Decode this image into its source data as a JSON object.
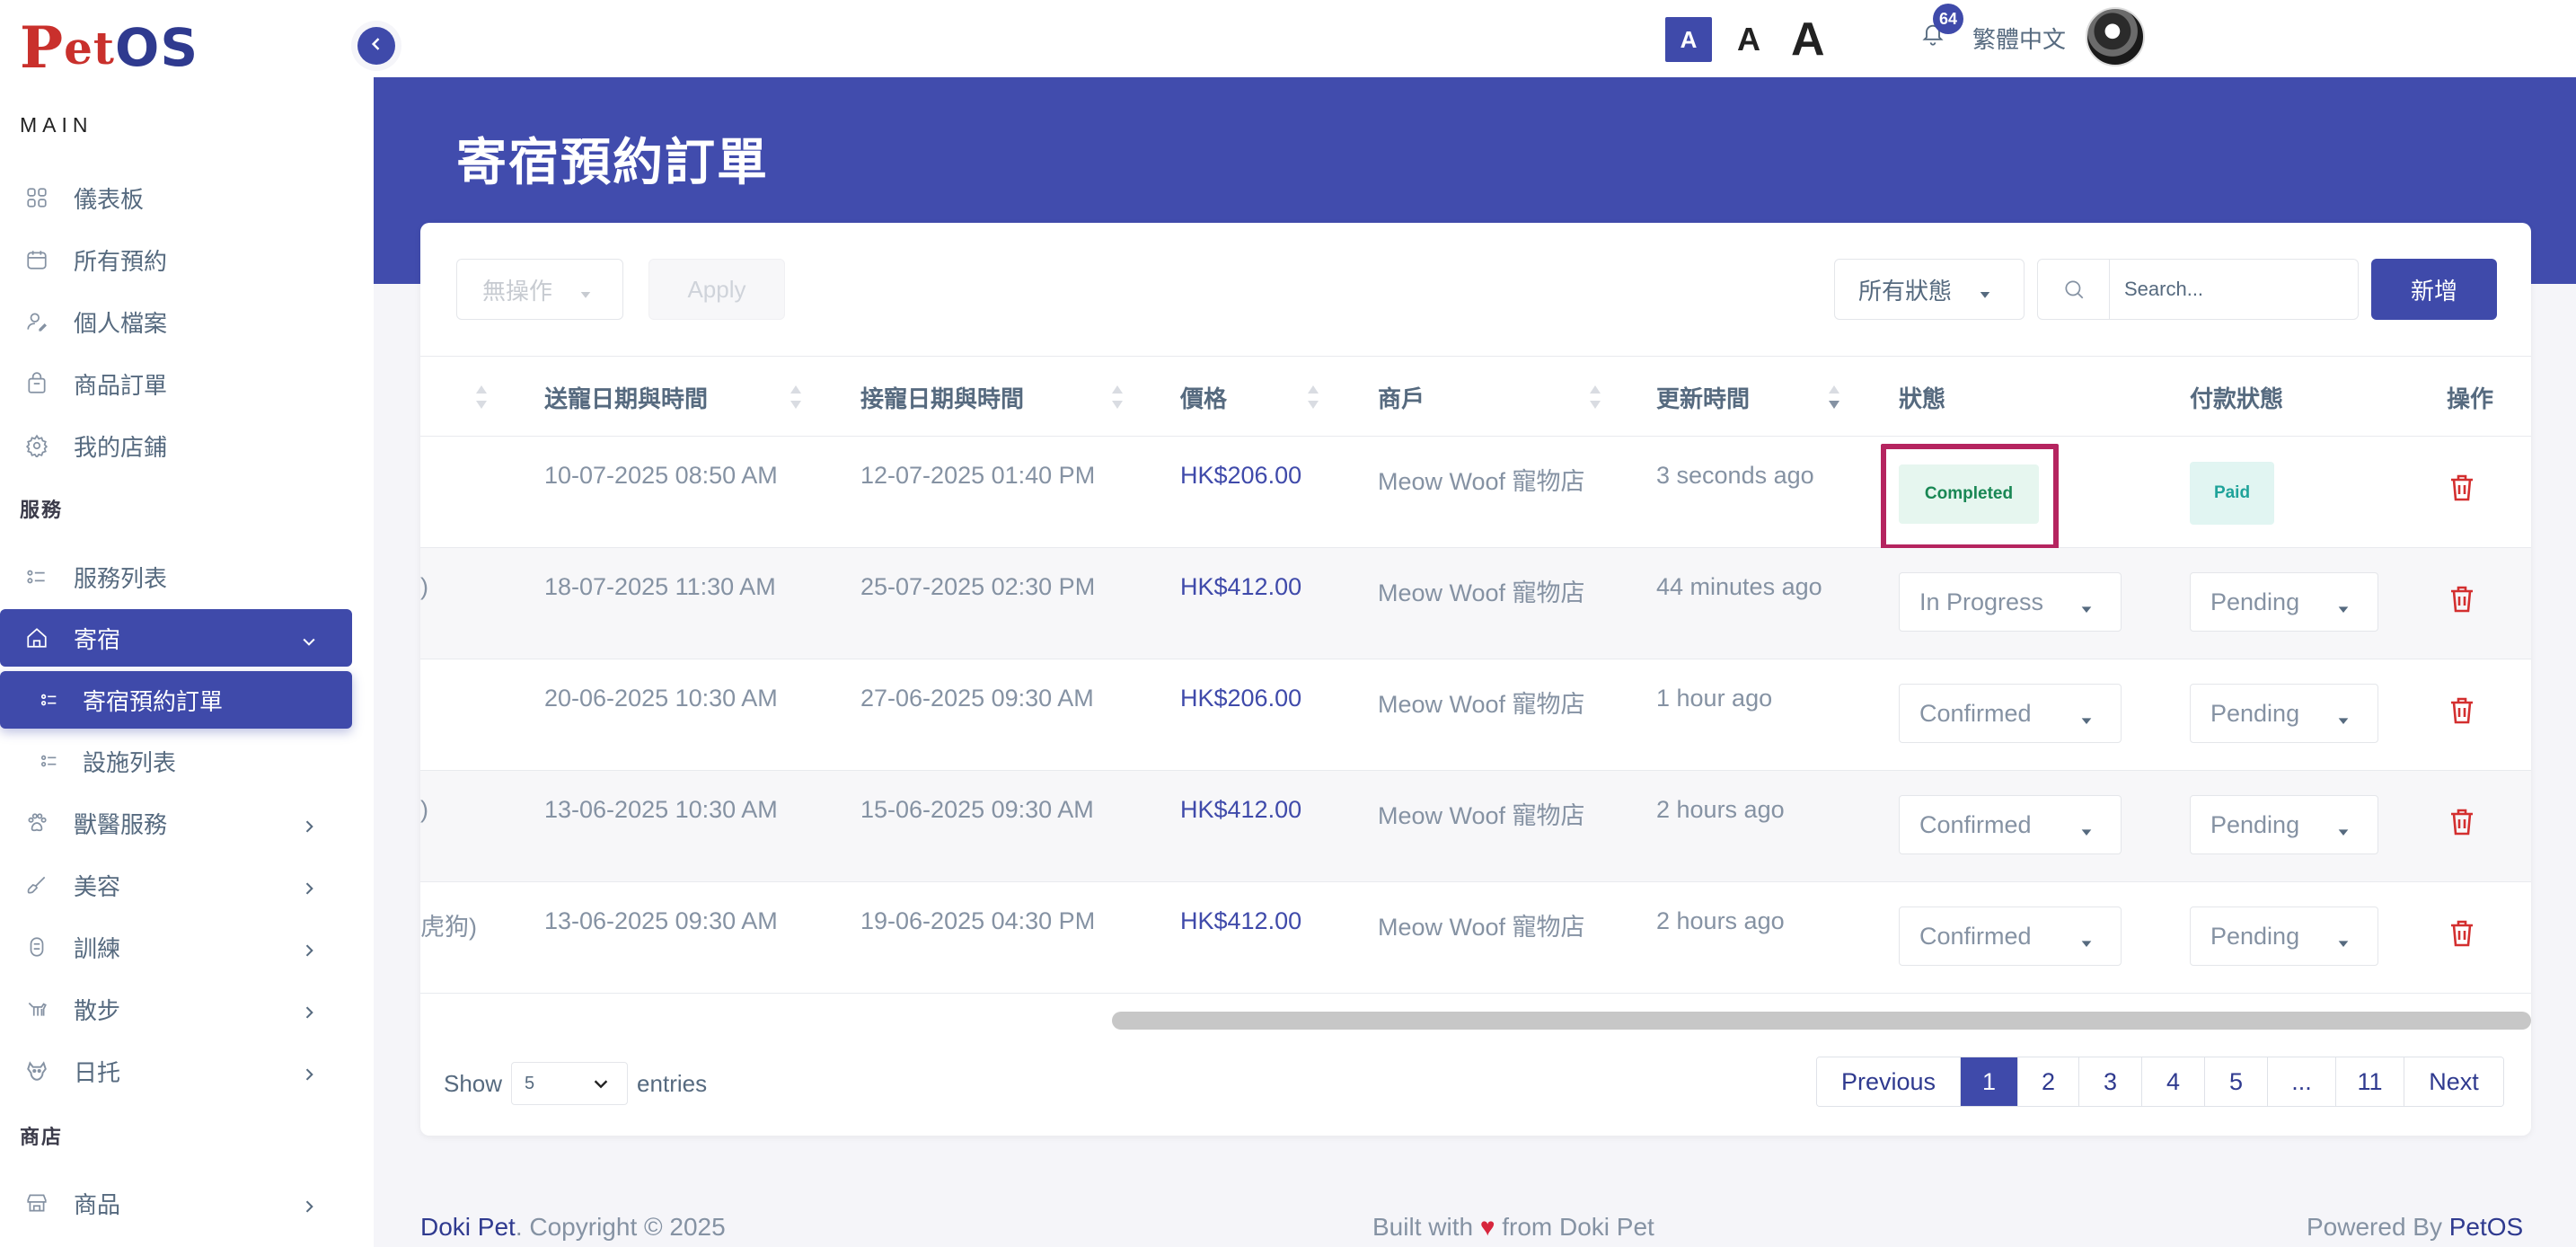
{
  "app": {
    "logo_p": "P",
    "logo_et": "et",
    "logo_os": "OS"
  },
  "sidebar": {
    "section_main": "MAIN",
    "section_services": "服務",
    "section_shop": "商店",
    "items": [
      {
        "label": "儀表板"
      },
      {
        "label": "所有預約"
      },
      {
        "label": "個人檔案"
      },
      {
        "label": "商品訂單"
      },
      {
        "label": "我的店鋪"
      },
      {
        "label": "服務列表"
      },
      {
        "label": "寄宿"
      },
      {
        "label": "寄宿預約訂單"
      },
      {
        "label": "設施列表"
      },
      {
        "label": "獸醫服務"
      },
      {
        "label": "美容"
      },
      {
        "label": "訓練"
      },
      {
        "label": "散步"
      },
      {
        "label": "日托"
      },
      {
        "label": "商品"
      }
    ]
  },
  "topbar": {
    "font_small": "A",
    "font_medium": "A",
    "font_large": "A",
    "notification_count": "64",
    "language": "繁體中文"
  },
  "page": {
    "title": "寄宿預約訂單"
  },
  "toolbar": {
    "bulk_action": "無操作",
    "apply_label": "Apply",
    "status_filter": "所有狀態",
    "search_placeholder": "Search...",
    "add_label": "新增"
  },
  "table": {
    "headers": [
      "送寵日期與時間",
      "接寵日期與時間",
      "價格",
      "商戶",
      "更新時間",
      "狀態",
      "付款狀態",
      "操作"
    ],
    "rows": [
      {
        "cut": "",
        "dropoff": "10-07-2025 08:50 AM",
        "pickup": "12-07-2025 01:40 PM",
        "price": "HK$206.00",
        "merchant": "Meow Woof 寵物店",
        "updated": "3 seconds ago",
        "status": "Completed",
        "payment": "Paid"
      },
      {
        "cut": ")",
        "dropoff": "18-07-2025 11:30 AM",
        "pickup": "25-07-2025 02:30 PM",
        "price": "HK$412.00",
        "merchant": "Meow Woof 寵物店",
        "updated": "44 minutes ago",
        "status": "In Progress",
        "payment": "Pending"
      },
      {
        "cut": "",
        "dropoff": "20-06-2025 10:30 AM",
        "pickup": "27-06-2025 09:30 AM",
        "price": "HK$206.00",
        "merchant": "Meow Woof 寵物店",
        "updated": "1 hour ago",
        "status": "Confirmed",
        "payment": "Pending"
      },
      {
        "cut": ")",
        "dropoff": "13-06-2025 10:30 AM",
        "pickup": "15-06-2025 09:30 AM",
        "price": "HK$412.00",
        "merchant": "Meow Woof 寵物店",
        "updated": "2 hours ago",
        "status": "Confirmed",
        "payment": "Pending"
      },
      {
        "cut": "虎狗)",
        "dropoff": "13-06-2025 09:30 AM",
        "pickup": "19-06-2025 04:30 PM",
        "price": "HK$412.00",
        "merchant": "Meow Woof 寵物店",
        "updated": "2 hours ago",
        "status": "Confirmed",
        "payment": "Pending"
      }
    ]
  },
  "pagination": {
    "show_label": "Show",
    "entries_value": "5",
    "entries_label": "entries",
    "previous": "Previous",
    "pages": [
      "1",
      "2",
      "3",
      "4",
      "5",
      "...",
      "11"
    ],
    "next": "Next"
  },
  "footer": {
    "brand": "Doki Pet",
    "copyright": ". Copyright © 2025",
    "built_prefix": "Built with ",
    "heart": "♥",
    "built_suffix": " from Doki Pet",
    "powered_prefix": "Powered By ",
    "powered_brand": "PetOS"
  },
  "colors": {
    "primary": "#3f4aaa",
    "danger": "#d32f2f",
    "highlight": "#b5245f",
    "success": "#198754"
  }
}
